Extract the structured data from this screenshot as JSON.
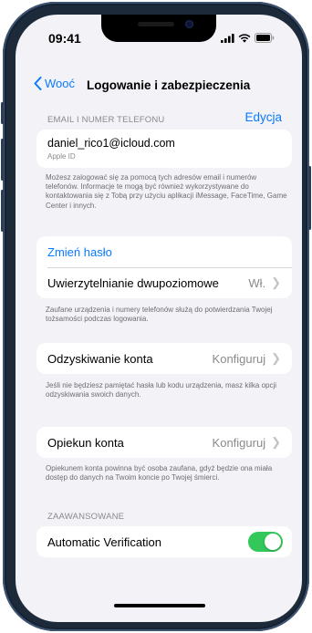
{
  "status_bar": {
    "time": "09:41"
  },
  "nav": {
    "back_label": "Wooć",
    "title": "Logowanie i zabezpieczenia"
  },
  "email_section": {
    "header": "EMAIL I NUMER TELEFONU",
    "edit_label": "Edycja",
    "email": "daniel_rico1@icloud.com",
    "email_sub": "Apple ID",
    "footer": "Możesz zalogować się za pomocą tych adresów email i numerów telefonów. Informacje te mogą być również wykorzystywane do kontaktowania się z Tobą przy użyciu aplikacji iMessage, FaceTime, Game Center i innych."
  },
  "password_section": {
    "change_password": "Zmień hasło",
    "two_factor_label": "Uwierzytelnianie dwupoziomowe",
    "two_factor_value": "Wł.",
    "footer": "Zaufane urządzenia i numery telefonów służą do potwierdzania Twojej tożsamości podczas logowania."
  },
  "recovery_section": {
    "label": "Odzyskiwanie konta",
    "value": "Konfiguruj",
    "footer": "Jeśli nie będziesz pamiętać hasła lub kodu urządzenia, masz kilka opcji odzyskiwania swoich danych."
  },
  "legacy_section": {
    "label": "Opiekun konta",
    "value": "Konfiguruj",
    "footer": "Opiekunem konta powinna być osoba zaufana, gdyż będzie ona miała dostęp do danych na Twoim koncie po Twojej śmierci."
  },
  "advanced_section": {
    "header": "ZAAWANSOWANE",
    "auto_verification_label": "Automatic Verification",
    "auto_verification_on": true
  },
  "colors": {
    "accent": "#0a7aff",
    "toggle_on": "#34c759",
    "background": "#f2f2f7"
  },
  "icons": [
    "chevron-left-icon",
    "chevron-right-icon",
    "signal-icon",
    "wifi-icon",
    "battery-icon"
  ]
}
